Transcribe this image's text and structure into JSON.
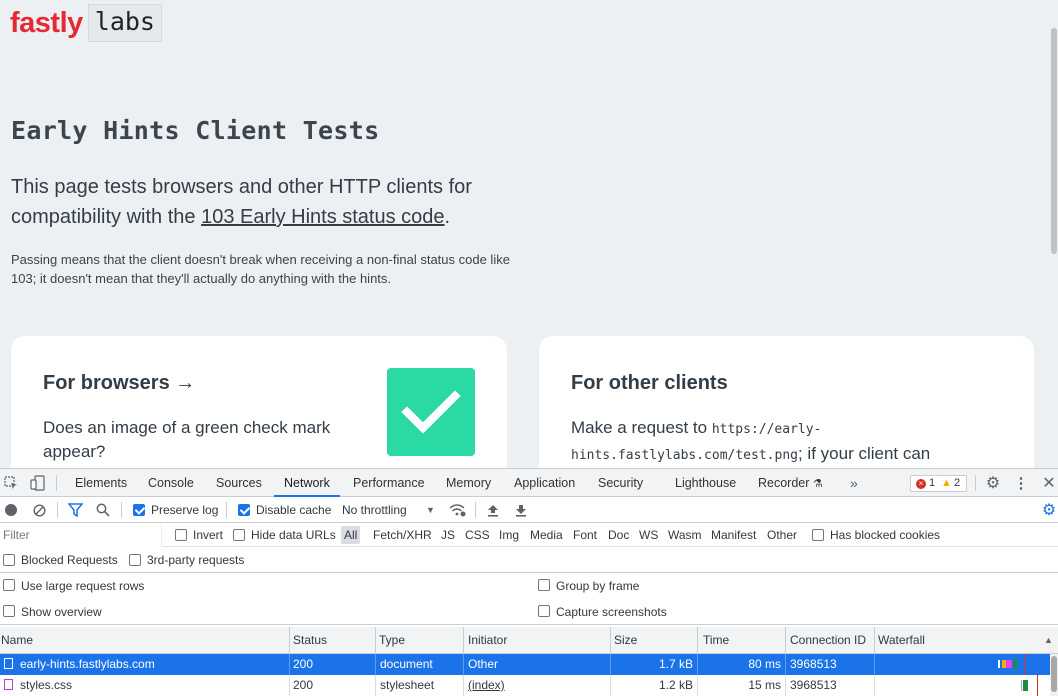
{
  "page": {
    "logo_brand": "fastly",
    "logo_suffix": "labs",
    "title": "Early Hints Client Tests",
    "lead_prefix": "This page tests browsers and other HTTP clients for compatibility with the ",
    "lead_link": "103 Early Hints status code",
    "lead_suffix": ".",
    "note": "Passing means that the client doesn't break when receiving a non-final status code like 103; it doesn't mean that they'll actually do anything with the hints.",
    "browsers_card": {
      "heading": "For browsers →",
      "body": "Does an image of a green check mark appear?"
    },
    "clients_card": {
      "heading": "For other clients",
      "body_prefix": "Make a request to ",
      "url": "https://early-hints.fastlylabs.com/test.png",
      "body_suffix": "; if your client can"
    }
  },
  "devtools": {
    "tabs": [
      "Elements",
      "Console",
      "Sources",
      "Network",
      "Performance",
      "Memory",
      "Application",
      "Security",
      "Lighthouse",
      "Recorder"
    ],
    "active_tab": "Network",
    "more_tabs": "»",
    "errors": "1",
    "warnings": "2",
    "toolbar": {
      "preserve_log": "Preserve log",
      "disable_cache": "Disable cache",
      "throttling": "No throttling"
    },
    "filter": {
      "placeholder": "Filter",
      "invert": "Invert",
      "hide_data_urls": "Hide data URLs",
      "types": [
        "All",
        "Fetch/XHR",
        "JS",
        "CSS",
        "Img",
        "Media",
        "Font",
        "Doc",
        "WS",
        "Wasm",
        "Manifest",
        "Other"
      ],
      "has_blocked_cookies": "Has blocked cookies",
      "blocked_requests": "Blocked Requests",
      "third_party": "3rd-party requests"
    },
    "settings": {
      "large_rows": "Use large request rows",
      "group_by_frame": "Group by frame",
      "show_overview": "Show overview",
      "capture_screenshots": "Capture screenshots"
    },
    "columns": [
      "Name",
      "Status",
      "Type",
      "Initiator",
      "Size",
      "Time",
      "Connection ID",
      "Waterfall"
    ],
    "rows": [
      {
        "name": "early-hints.fastlylabs.com",
        "status": "200",
        "type": "document",
        "initiator": "Other",
        "size": "1.7 kB",
        "time": "80 ms",
        "connection": "3968513"
      },
      {
        "name": "styles.css",
        "status": "200",
        "type": "stylesheet",
        "initiator": "(index)",
        "size": "1.2 kB",
        "time": "15 ms",
        "connection": "3968513"
      }
    ],
    "colors": {
      "accent": "#1a73e8",
      "error": "#d93025",
      "warning": "#f9ab00",
      "check_green": "#2bd9a4",
      "brand_red": "#e42a32"
    }
  }
}
